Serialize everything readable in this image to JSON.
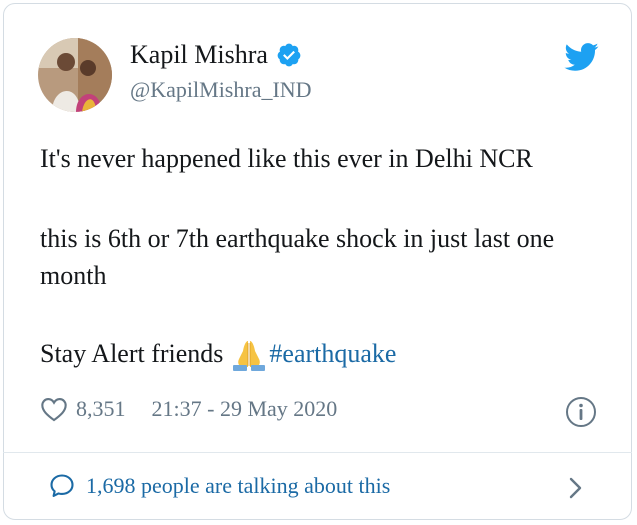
{
  "author": {
    "name": "Kapil Mishra",
    "handle": "@KapilMishra_IND",
    "verified": true
  },
  "tweet": {
    "line1": "It's never happened like this ever in Delhi NCR",
    "line2": "this is 6th or 7th earthquake shock in just last one month",
    "line3_text": "Stay Alert friends",
    "line3_emoji": "folded-hands-emoji",
    "hashtag": "#earthquake"
  },
  "meta": {
    "likes": "8,351",
    "timestamp": "21:37 - 29 May 2020"
  },
  "footer": {
    "talking": "1,698 people are talking about this"
  },
  "colors": {
    "link": "#1b6aa5",
    "muted": "#657786",
    "twitter_blue": "#1da1f2",
    "text": "#14171a"
  },
  "icons": [
    "verified-badge-icon",
    "twitter-bird-icon",
    "heart-icon",
    "info-icon",
    "comment-bubble-icon",
    "chevron-right-icon"
  ]
}
